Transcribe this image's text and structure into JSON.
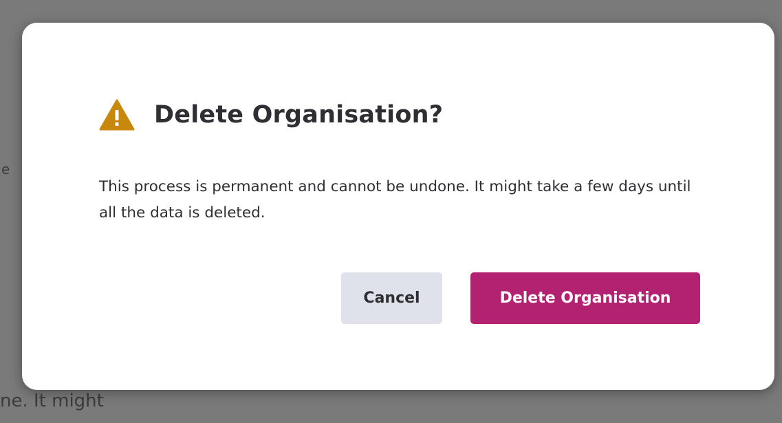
{
  "background": {
    "fragment_top": "e",
    "fragment_bottom": "ne. It might"
  },
  "dialog": {
    "title": "Delete Organisation?",
    "message": "This process is permanent and cannot be undone. It might take a few days until all the data is deleted.",
    "cancel_label": "Cancel",
    "confirm_label": "Delete Organisation",
    "icon": "warning-triangle-icon",
    "colors": {
      "warning": "#c8880e",
      "confirm_bg": "#b22271",
      "cancel_bg": "#dfe2ea",
      "text": "#2f2f33"
    }
  }
}
